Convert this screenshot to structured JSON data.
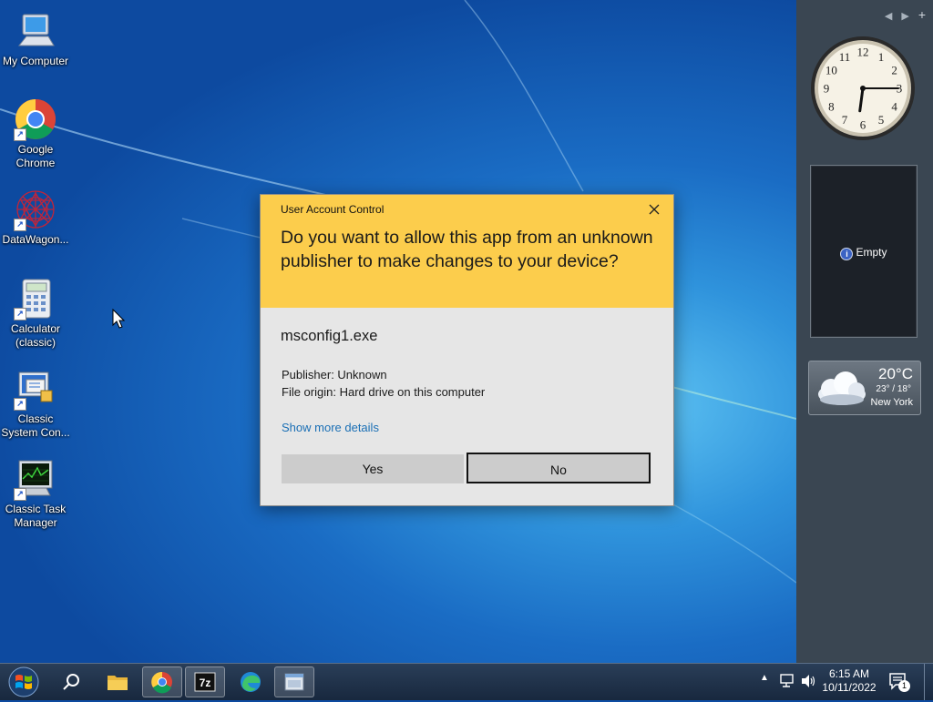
{
  "desktop": {
    "icons": [
      {
        "label": "My Computer",
        "icon": "computer-icon"
      },
      {
        "label": "Google Chrome",
        "icon": "chrome-icon"
      },
      {
        "label": "DataWagon...",
        "icon": "datawagon-icon"
      },
      {
        "label": "Calculator (classic)",
        "icon": "calculator-icon"
      },
      {
        "label": "Classic System Con...",
        "icon": "system-config-icon"
      },
      {
        "label": "Classic Task Manager",
        "icon": "task-manager-icon"
      }
    ]
  },
  "uac": {
    "title": "User Account Control",
    "question": "Do you want to allow this app from an unknown publisher to make changes to your device?",
    "app_name": "msconfig1.exe",
    "publisher": "Publisher: Unknown",
    "origin": "File origin: Hard drive on this computer",
    "more_details": "Show more details",
    "yes_label": "Yes",
    "no_label": "No",
    "header_color": "#fccd4c"
  },
  "sidebar": {
    "clock": {
      "hour": 6,
      "minute": 15
    },
    "slideshow_text": "Empty",
    "weather": {
      "temp": "20°C",
      "range": "23° / 18°",
      "city": "New York"
    }
  },
  "taskbar": {
    "time": "6:15 AM",
    "date": "10/11/2022",
    "items": [
      "start",
      "search",
      "file-explorer",
      "chrome",
      "7zip",
      "edge",
      "window-app"
    ],
    "notification_count": "1"
  }
}
